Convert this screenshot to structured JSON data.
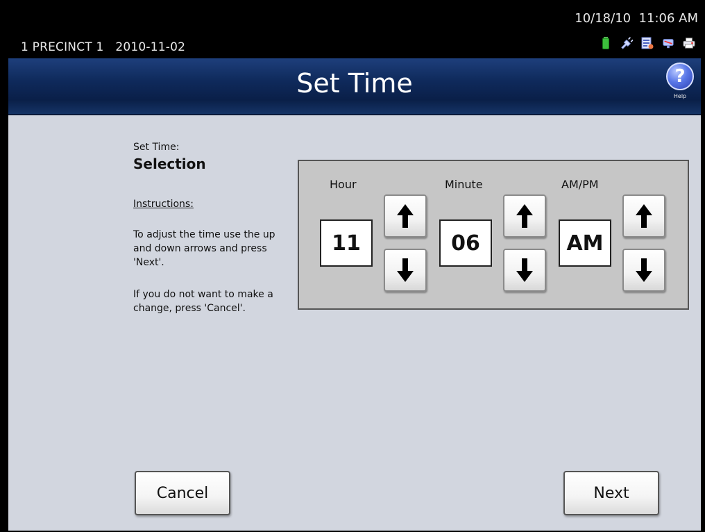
{
  "status": {
    "precinct": "1 PRECINCT 1",
    "election_date": "2010-11-02",
    "datetime": "10/18/10  11:06 AM",
    "icons": [
      "battery-icon",
      "power-plug-icon",
      "document-icon",
      "network-icon",
      "printer-icon"
    ]
  },
  "header": {
    "title": "Set Time",
    "help_label": "Help",
    "help_symbol": "?"
  },
  "instructions": {
    "subtitle": "Set Time:",
    "heading": "Selection",
    "label": "Instructions:",
    "paragraph1": "To adjust the time use the up and down arrows and press 'Next'.",
    "paragraph2": "If you do not want to make a change, press 'Cancel'."
  },
  "time": {
    "hour": {
      "label": "Hour",
      "value": "11"
    },
    "minute": {
      "label": "Minute",
      "value": "06"
    },
    "ampm": {
      "label": "AM/PM",
      "value": "AM"
    }
  },
  "buttons": {
    "cancel": "Cancel",
    "next": "Next"
  },
  "colors": {
    "title_bar": "#0f2a5c",
    "background": "#d2d6df",
    "panel": "#c6c6c6"
  }
}
